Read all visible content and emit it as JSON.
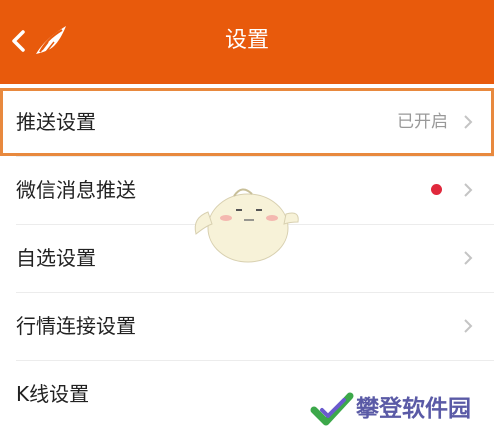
{
  "header": {
    "title": "设置",
    "background": "#e85a0c",
    "back_icon": "chevron-left-icon",
    "logo_icon": "app-logo-icon"
  },
  "settings": {
    "items": [
      {
        "label": "推送设置",
        "status": "已开启",
        "selected": true
      },
      {
        "label": "微信消息推送",
        "badge": "red-dot",
        "badge_color": "#e0283c"
      },
      {
        "label": "自选设置"
      },
      {
        "label": "行情连接设置"
      },
      {
        "label": "K线设置"
      }
    ],
    "highlight_color": "#e8893e"
  },
  "watermark": {
    "text": "攀登软件园",
    "icon": "check-logo-icon"
  }
}
